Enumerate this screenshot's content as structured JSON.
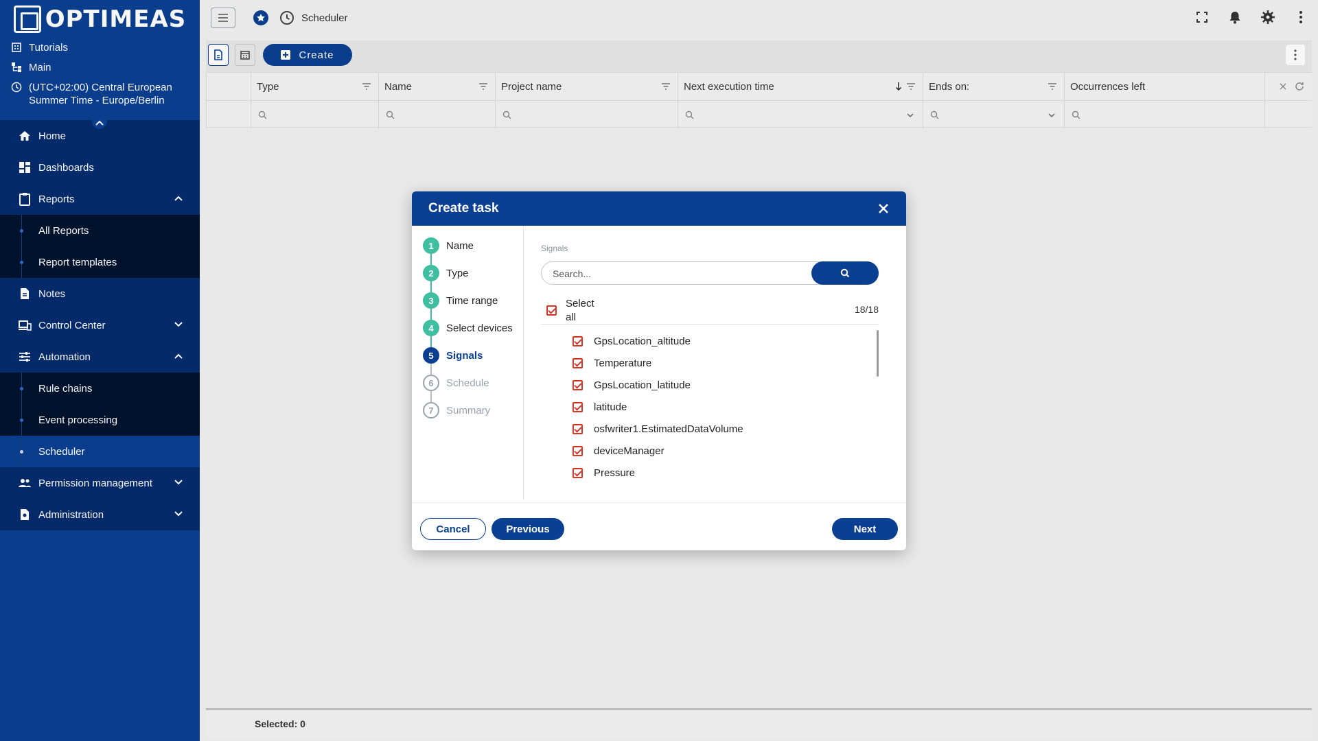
{
  "app": {
    "logo_text": "OPTIMEAS"
  },
  "context": {
    "tutorials": "Tutorials",
    "main": "Main",
    "timezone_line1": "(UTC+02:00) Central European",
    "timezone_line2": "Summer Time - Europe/Berlin"
  },
  "sidebar": {
    "home": "Home",
    "dashboards": "Dashboards",
    "reports": "Reports",
    "all_reports": "All Reports",
    "report_templates": "Report templates",
    "notes": "Notes",
    "control_center": "Control Center",
    "automation": "Automation",
    "rule_chains": "Rule chains",
    "event_processing": "Event processing",
    "scheduler": "Scheduler",
    "permission_management": "Permission management",
    "administration": "Administration"
  },
  "topbar": {
    "breadcrumb": "Scheduler"
  },
  "toolbar": {
    "create_label": "Create"
  },
  "grid": {
    "columns": [
      "Type",
      "Name",
      "Project name",
      "Next execution time",
      "Ends on:",
      "Occurrences left"
    ],
    "sort_column": "Next execution time",
    "sort_direction": "descending"
  },
  "status": {
    "selected": "Selected: 0"
  },
  "dialog": {
    "title": "Create task",
    "steps": [
      {
        "num": "1",
        "label": "Name",
        "state": "done"
      },
      {
        "num": "2",
        "label": "Type",
        "state": "done"
      },
      {
        "num": "3",
        "label": "Time range",
        "state": "done"
      },
      {
        "num": "4",
        "label": "Select devices",
        "state": "done"
      },
      {
        "num": "5",
        "label": "Signals",
        "state": "current"
      },
      {
        "num": "6",
        "label": "Schedule",
        "state": "todo"
      },
      {
        "num": "7",
        "label": "Summary",
        "state": "todo"
      }
    ],
    "signals_label": "Signals",
    "search_placeholder": "Search...",
    "select_all_label": "Select all",
    "select_all_count": "18/18",
    "signals": [
      "GpsLocation_altitude",
      "Temperature",
      "GpsLocation_latitude",
      "latitude",
      "osfwriter1.EstimatedDataVolume",
      "deviceManager",
      "Pressure"
    ],
    "cancel": "Cancel",
    "previous": "Previous",
    "next": "Next"
  },
  "colors": {
    "primary": "#0b3f91",
    "step_done": "#3fbf9f",
    "checkbox": "#d8352b"
  }
}
